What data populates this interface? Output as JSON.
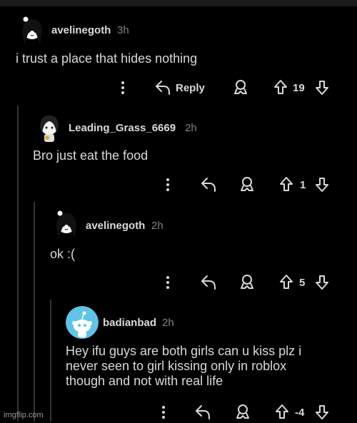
{
  "comments": [
    {
      "username": "avelinegoth",
      "time": "3h",
      "body": "i trust a place that hides nothing",
      "reply_label": "Reply",
      "score": "19",
      "avatar": "anime-girl-avatar-icon"
    },
    {
      "username": "Leading_Grass_6669",
      "time": "2h",
      "body": "Bro just eat the food",
      "reply_label": "",
      "score": "1",
      "avatar": "anime-girl-avatar-icon"
    },
    {
      "username": "avelinegoth",
      "time": "2h",
      "body": "ok :(",
      "reply_label": "",
      "score": "5",
      "avatar": "anime-girl-avatar-icon"
    },
    {
      "username": "badianbad",
      "time": "2h",
      "body_lines": [
        "Hey ifu guys are both girls can u kiss plz i",
        "never seen to girl kissing only in roblox",
        "though and not with real life"
      ],
      "reply_label": "",
      "score": "-4",
      "avatar": "snoo-avatar-icon"
    }
  ],
  "watermark": "imgflip.com",
  "colors": {
    "background": "#000000",
    "text": "#d7dadc",
    "muted": "#818384",
    "snoo_bg": "#5fc4e8"
  },
  "icons": [
    "more-vertical-icon",
    "reply-arrow-icon",
    "award-icon",
    "upvote-icon",
    "downvote-icon"
  ]
}
